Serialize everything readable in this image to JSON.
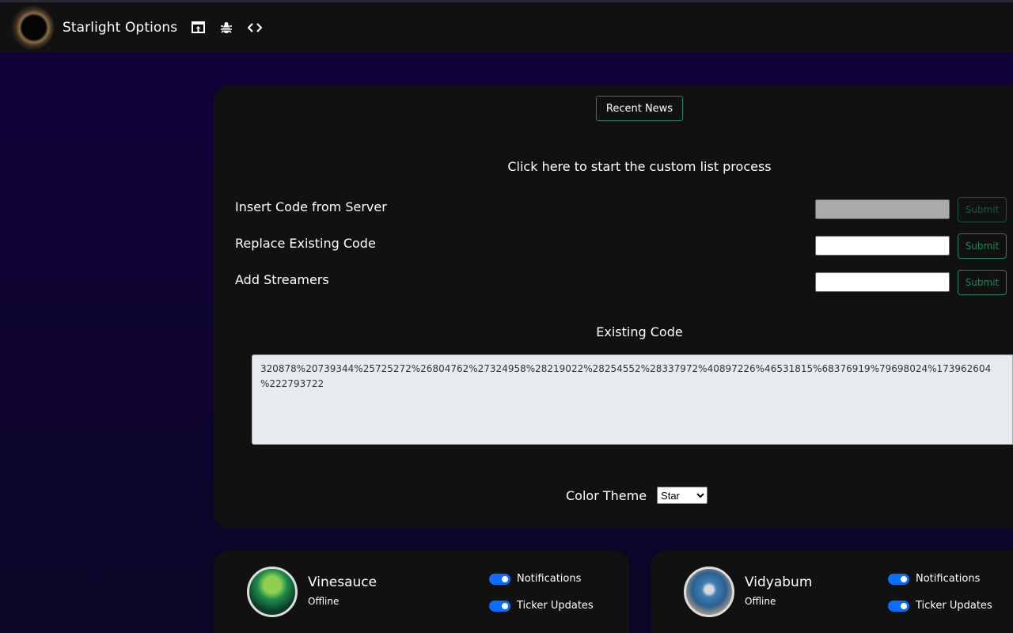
{
  "header": {
    "title": "Starlight Options",
    "icons": [
      "window-upload-icon",
      "bug-icon",
      "code-icon"
    ]
  },
  "main": {
    "recent_news_label": "Recent News",
    "start_custom_list": "Click here to start the custom list process",
    "rows": [
      {
        "label": "Insert Code from Server",
        "value": "",
        "disabled": true,
        "button": "Submit"
      },
      {
        "label": "Replace Existing Code",
        "value": "",
        "disabled": false,
        "button": "Submit"
      },
      {
        "label": "Add Streamers",
        "value": "",
        "disabled": false,
        "button": "Submit"
      }
    ],
    "existing_code_title": "Existing Code",
    "existing_code": "320878%20739344%25725272%26804762%27324958%28219022%28254552%28337972%40897226%46531815%68376919%79698024%173962604\n%222793722",
    "color_theme_label": "Color Theme",
    "color_theme_value": "Star"
  },
  "streamers": [
    {
      "name": "Vinesauce",
      "status": "Offline",
      "notifications_label": "Notifications",
      "notifications": true,
      "ticker_label": "Ticker Updates",
      "ticker": true
    },
    {
      "name": "Vidyabum",
      "status": "Offline",
      "notifications_label": "Notifications",
      "notifications": true,
      "ticker_label": "Ticker Updates",
      "ticker": true
    }
  ],
  "colors": {
    "accent_green": "#198754",
    "toggle_blue": "#0d6efd",
    "panel": "#111111"
  }
}
